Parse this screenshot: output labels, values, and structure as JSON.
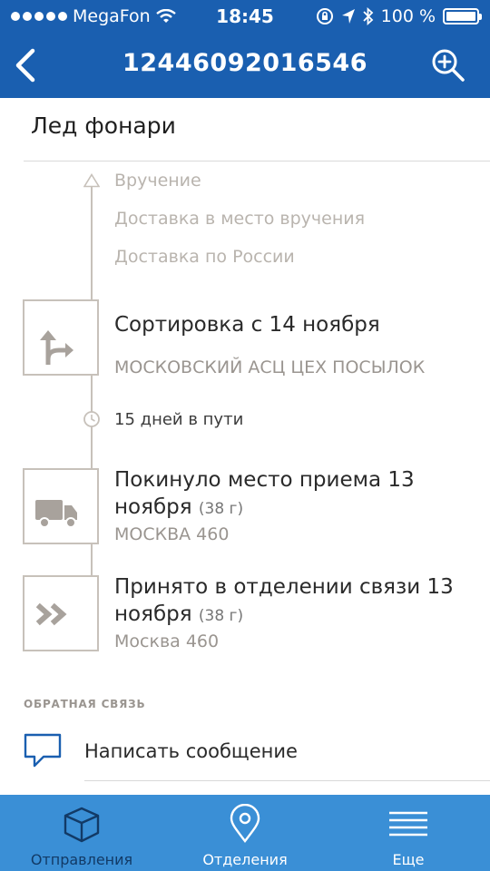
{
  "status_bar": {
    "carrier": "MegaFon",
    "time": "18:45",
    "battery": "100 %"
  },
  "nav": {
    "title": "12446092016546",
    "back_icon": "chevron-left-icon",
    "zoom_icon": "zoom-in-icon"
  },
  "item": {
    "title": "Лед фонари"
  },
  "future_steps": [
    "Вручение",
    "Доставка в место вручения",
    "Доставка по России"
  ],
  "events": [
    {
      "icon": "sort-arrow-icon",
      "title": "Сортировка с 14 ноября",
      "weight": "",
      "subtitle": "МОСКОВСКИЙ АСЦ ЦЕХ ПОСЫЛОК"
    },
    {
      "icon": "truck-icon",
      "title_line1": "Покинуло место приема 13",
      "title_line2": "ноября",
      "weight": "(38 г)",
      "subtitle": "МОСКВА 460"
    },
    {
      "icon": "double-chevron-icon",
      "title_line1": "Принято в отделении связи 13",
      "title_line2": "ноября",
      "weight": "(38 г)",
      "subtitle": "Москва 460"
    }
  ],
  "transit": {
    "text": "15 дней в пути"
  },
  "feedback": {
    "header": "ОБРАТНАЯ СВЯЗЬ",
    "action": "Написать сообщение"
  },
  "tabs": [
    {
      "label": "Отправления",
      "icon": "box-icon",
      "active": true
    },
    {
      "label": "Отделения",
      "icon": "location-pin-icon",
      "active": false
    },
    {
      "label": "Еще",
      "icon": "menu-icon",
      "active": false
    }
  ],
  "colors": {
    "nav_bg": "#1a5fb0",
    "tabbar_bg": "#3a8fd6",
    "active_tab": "#123a66",
    "timeline": "#c7c1ba"
  }
}
